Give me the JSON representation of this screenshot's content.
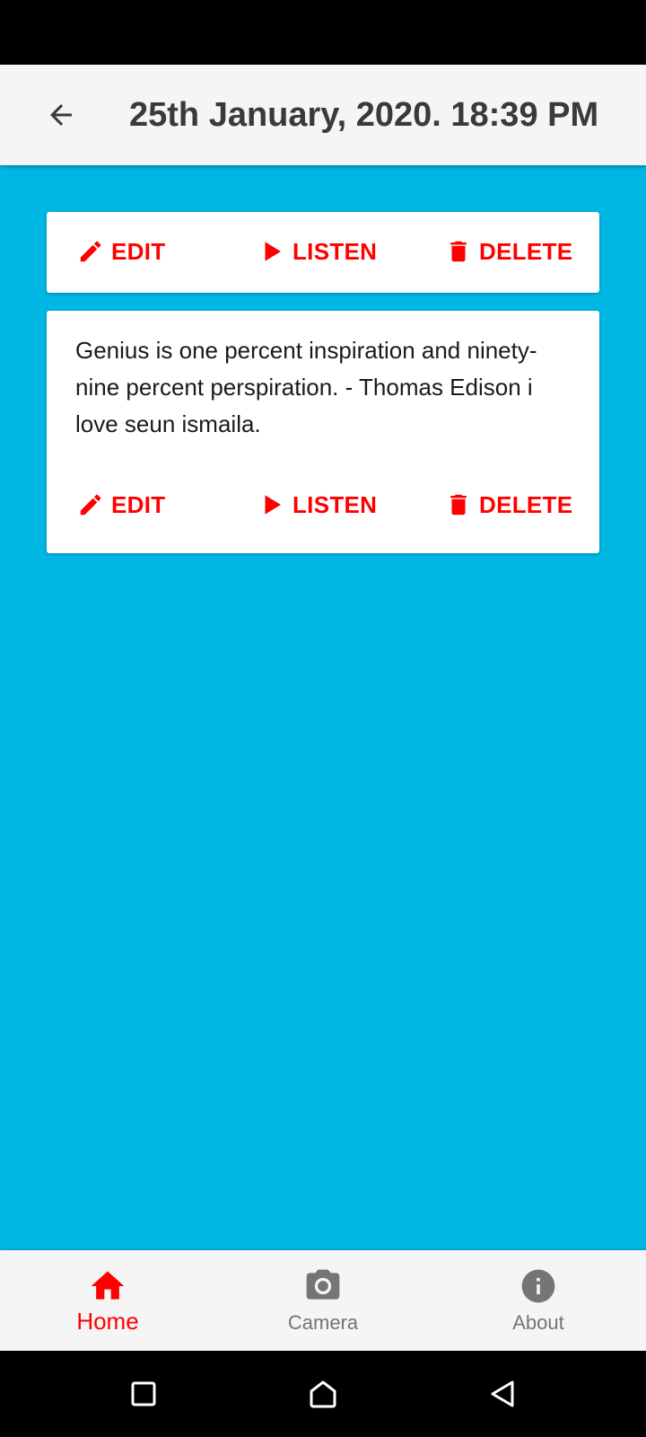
{
  "app_bar": {
    "title": "25th January, 2020. 18:39 PM",
    "back_icon": "arrow-back-icon"
  },
  "colors": {
    "accent": "#ff0000",
    "background": "#00b7e4",
    "bar": "#f5f5f5"
  },
  "cards": [
    {
      "text": "",
      "actions": {
        "edit": "EDIT",
        "listen": "LISTEN",
        "delete": "DELETE"
      }
    },
    {
      "text": "Genius is one percent inspiration and ninety-nine percent perspiration. - Thomas Edison i love seun ismaila.",
      "actions": {
        "edit": "EDIT",
        "listen": "LISTEN",
        "delete": "DELETE"
      }
    }
  ],
  "bottom_nav": {
    "items": [
      {
        "label": "Home",
        "icon": "home-icon",
        "active": true
      },
      {
        "label": "Camera",
        "icon": "camera-icon",
        "active": false
      },
      {
        "label": "About",
        "icon": "info-icon",
        "active": false
      }
    ]
  },
  "system_nav": [
    "recents-icon",
    "home-circle-icon",
    "back-triangle-icon"
  ]
}
